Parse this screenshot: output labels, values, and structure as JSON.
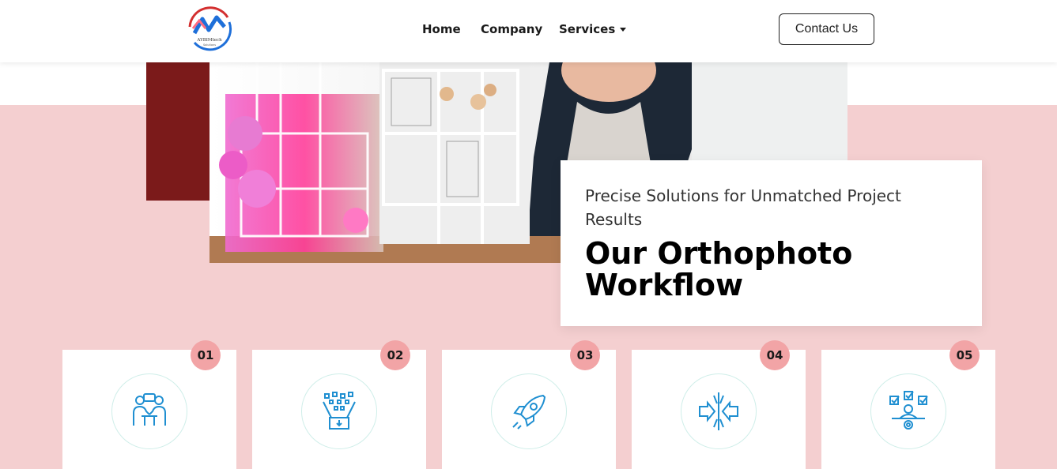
{
  "header": {
    "logo_text": "AYBIMtech",
    "logo_subtext": "Solutions",
    "nav": {
      "home": "Home",
      "company": "Company",
      "services": "Services"
    },
    "contact_label": "Contact Us"
  },
  "hero": {
    "subtitle": "Precise Solutions for Unmatched Project Results",
    "title": "Our Orthophoto Workflow"
  },
  "steps": [
    {
      "number": "01",
      "icon": "consultation-icon"
    },
    {
      "number": "02",
      "icon": "data-collection-icon"
    },
    {
      "number": "03",
      "icon": "rocket-launch-icon"
    },
    {
      "number": "04",
      "icon": "focus-converge-icon"
    },
    {
      "number": "05",
      "icon": "task-management-icon"
    }
  ],
  "colors": {
    "pink_band": "#f4cfd0",
    "maroon": "#7b1a1a",
    "badge": "#f2a4a6",
    "icon_blue": "#1f8fd1"
  }
}
